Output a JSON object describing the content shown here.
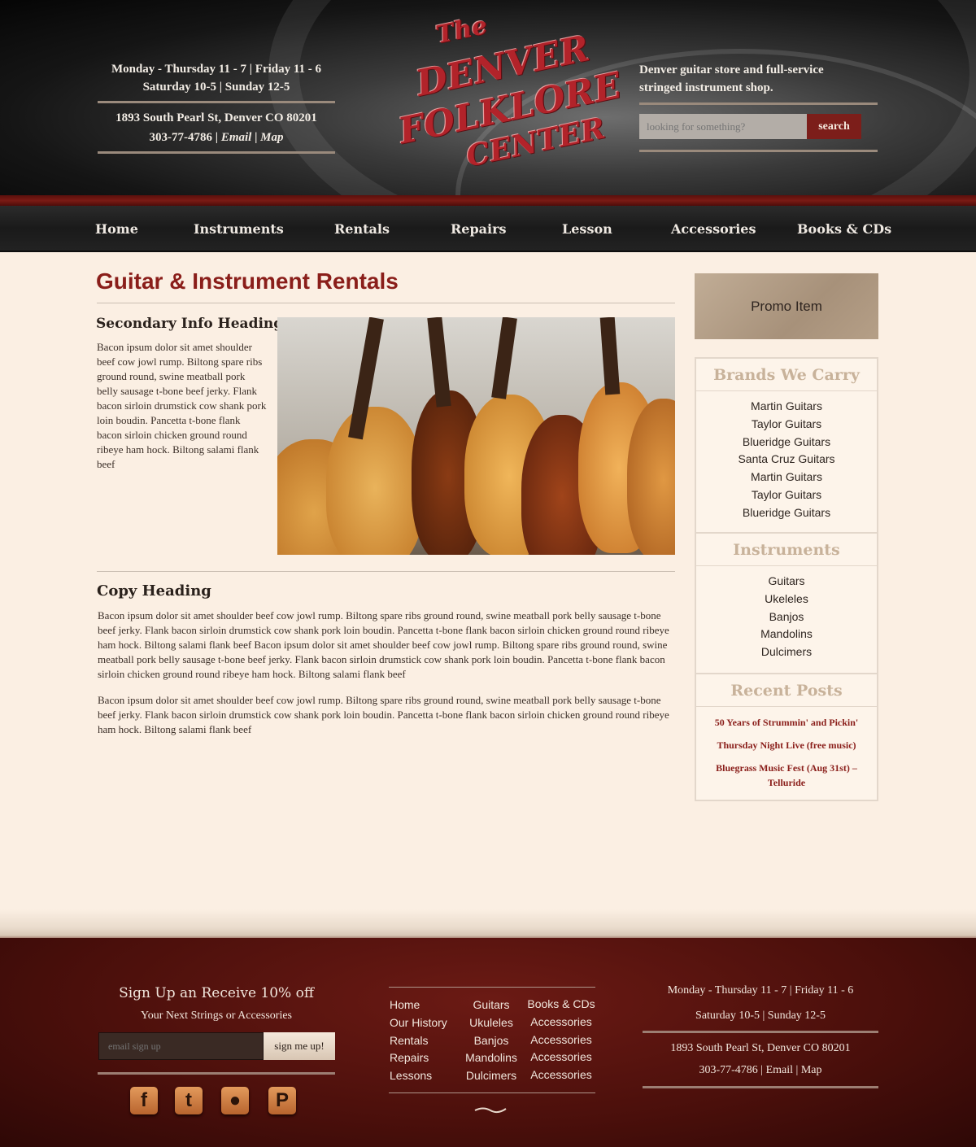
{
  "header": {
    "hours_line1": "Monday - Thursday 11 - 7 | Friday 11 - 6",
    "hours_line2": "Saturday 10-5 | Sunday 12-5",
    "address": "1893 South Pearl St, Denver CO 80201",
    "phone": "303-77-4786",
    "email_link": "Email",
    "map_link": "Map",
    "tagline_line1": "Denver guitar store and full-service",
    "tagline_line2": "stringed instrument shop.",
    "search_placeholder": "looking for something?",
    "search_button": "search",
    "logo": {
      "the": "The",
      "denver": "DENVER",
      "folklore": "FOLKLORE",
      "center": "CENTER"
    }
  },
  "nav": [
    "Home",
    "Instruments",
    "Rentals",
    "Repairs",
    "Lesson",
    "Accessories",
    "Books & CDs"
  ],
  "main": {
    "page_title": "Guitar & Instrument Rentals",
    "secondary_heading": "Secondary Info Heading",
    "secondary_body": "Bacon ipsum dolor sit amet shoulder beef cow jowl rump. Biltong spare ribs ground round, swine meatball pork belly sausage t-bone beef jerky. Flank bacon sirloin drumstick cow shank pork loin boudin. Pancetta t-bone flank bacon sirloin chicken ground round ribeye ham hock. Biltong salami flank beef",
    "copy_heading": "Copy Heading",
    "copy_p1": "Bacon ipsum dolor sit amet shoulder beef cow jowl rump. Biltong spare ribs ground round, swine meatball pork belly sausage t-bone beef jerky. Flank bacon sirloin drumstick cow shank pork loin boudin. Pancetta t-bone flank bacon sirloin chicken ground round ribeye ham hock. Biltong salami flank beef Bacon ipsum dolor sit amet shoulder beef cow jowl rump. Biltong spare ribs ground round, swine meatball pork belly sausage t-bone beef jerky. Flank bacon sirloin drumstick cow shank pork loin boudin. Pancetta t-bone flank bacon sirloin chicken ground round ribeye ham hock. Biltong salami flank beef",
    "copy_p2": "Bacon ipsum dolor sit amet shoulder beef cow jowl rump. Biltong spare ribs ground round, swine meatball pork belly sausage t-bone beef jerky. Flank bacon sirloin drumstick cow shank pork loin boudin. Pancetta t-bone flank bacon sirloin chicken ground round ribeye ham hock. Biltong salami flank beef"
  },
  "sidebar": {
    "promo": "Promo Item",
    "brands_heading": "Brands We Carry",
    "brands": [
      "Martin Guitars",
      "Taylor Guitars",
      "Blueridge Guitars",
      "Santa Cruz Guitars",
      "Martin Guitars",
      "Taylor Guitars",
      "Blueridge Guitars"
    ],
    "instruments_heading": "Instruments",
    "instruments": [
      "Guitars",
      "Ukeleles",
      "Banjos",
      "Mandolins",
      "Dulcimers"
    ],
    "posts_heading": "Recent Posts",
    "posts": [
      "50 Years of Strummin' and Pickin'",
      "Thursday Night Live (free music)",
      "Bluegrass Music Fest (Aug 31st) – Telluride"
    ]
  },
  "footer": {
    "signup_title": "Sign Up an Receive 10% off",
    "signup_sub": "Your Next Strings or Accessories",
    "email_placeholder": "email sign up",
    "signup_button": "sign me up!",
    "social": [
      "facebook-icon",
      "twitter-icon",
      "flickr-icon",
      "pandora-icon"
    ],
    "col1": [
      "Home",
      "Our History",
      "Rentals",
      "Repairs",
      "Lessons"
    ],
    "col2": [
      "Guitars",
      "Ukuleles",
      "Banjos",
      "Mandolins",
      "Dulcimers"
    ],
    "col3": [
      "Books & CDs",
      "Accessories",
      "Accessories",
      "Accessories",
      "Accessories"
    ],
    "hours_line1": "Monday - Thursday 11 - 7 | Friday 11 - 6",
    "hours_line2": "Saturday 10-5 | Sunday 12-5",
    "address": "1893 South Pearl St, Denver CO 80201",
    "phone": "303-77-4786",
    "email_link": "Email",
    "map_link": "Map"
  }
}
